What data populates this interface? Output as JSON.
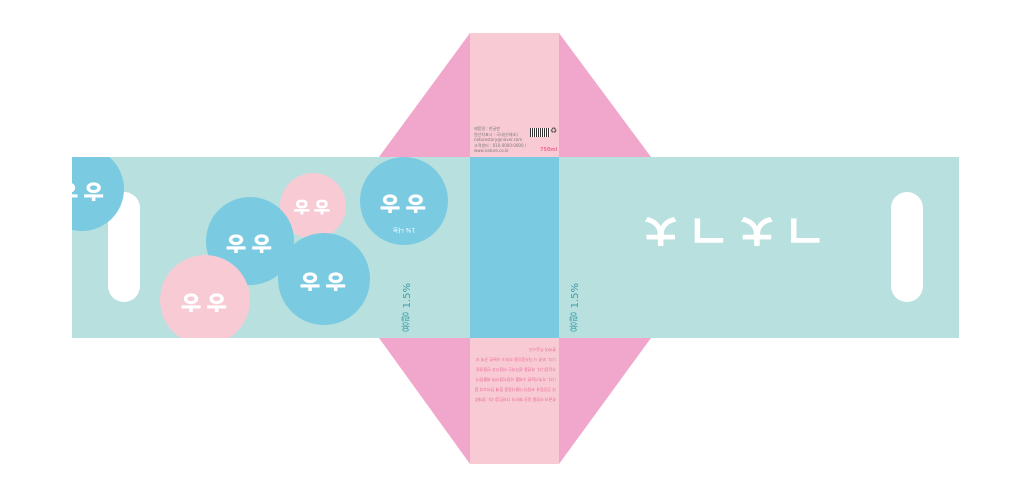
{
  "colors": {
    "mint": "#b7e0de",
    "sky_blue": "#7acae1",
    "light_pink": "#f8cad4",
    "pink": "#f0a7cb",
    "white": "#ffffff"
  },
  "brand_mark": "ㄱㅊㄱㅊ",
  "circle_glyph": "ㅎㅎ",
  "circle_badge": "1% 나눔",
  "volume_label": "용량 1.5%",
  "panel_top": {
    "info_lines": [
      "제품명 : 한글판",
      "원산지표시 : 국내산(제조)",
      "naturestory@naver.com",
      "고객센터 : 010-0000-0000 / www.nature.co.kr"
    ],
    "size": "750ml"
  },
  "panel_bottom": {
    "description": "한글과 자연을 담은 패키지 디자인입니다. 원재료의 건강함과 포장의 아름다움을 함께 전하고자 합니다. 지속가능한 소재를 사용하였으며 재활용이 가능합니다. 자연을 생각하는 마음으로 만들었습니다. 보관 시 직사광선을 피하고 서늘한 곳에 보관하여 주십시오."
  }
}
